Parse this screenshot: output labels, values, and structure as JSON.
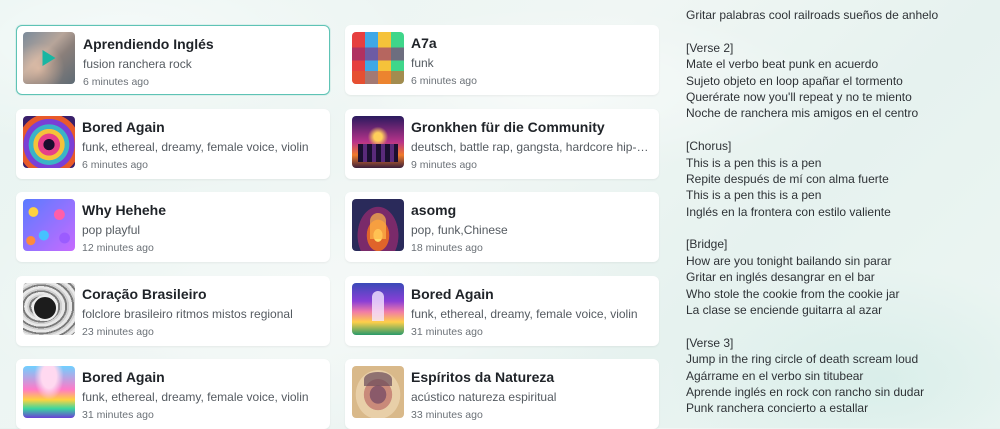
{
  "songs": [
    {
      "title": "Aprendiendo Inglés",
      "tags": "fusion ranchera rock",
      "time": "6 minutes ago",
      "art": "aprendiendo-cover"
    },
    {
      "title": "A7a",
      "tags": "funk",
      "time": "6 minutes ago",
      "art": "a7a-cover"
    },
    {
      "title": "Bored Again",
      "tags": "funk, ethereal, dreamy, female voice, violin",
      "time": "6 minutes ago",
      "art": "bored-again-cover-1"
    },
    {
      "title": "Gronkhen für die Community",
      "tags": "deutsch, battle rap, gangsta, hardcore hip-hop",
      "time": "9 minutes ago",
      "art": "gronkhen-cover"
    },
    {
      "title": "Why Hehehe",
      "tags": "pop playful",
      "time": "12 minutes ago",
      "art": "why-hehehe-cover"
    },
    {
      "title": "asomg",
      "tags": "pop, funk,Chinese",
      "time": "18 minutes ago",
      "art": "asomg-cover"
    },
    {
      "title": "Coração Brasileiro",
      "tags": "folclore brasileiro ritmos mistos regional",
      "time": "23 minutes ago",
      "art": "coracao-cover"
    },
    {
      "title": "Bored Again",
      "tags": "funk, ethereal, dreamy, female voice, violin",
      "time": "31 minutes ago",
      "art": "bored-again-cover-2"
    },
    {
      "title": "Bored Again",
      "tags": "funk, ethereal, dreamy, female voice, violin",
      "time": "31 minutes ago",
      "art": "bored-again-cover-3"
    },
    {
      "title": "Espíritos da Natureza",
      "tags": "acústico natureza espiritual",
      "time": "33 minutes ago",
      "art": "espiritos-cover"
    }
  ],
  "lyrics": [
    "Gritar palabras cool railroads sueños de anhelo",
    "",
    "[Verse 2]",
    "Mate el verbo beat punk en acuerdo",
    "Sujeto objeto en loop apañar el tormento",
    "Querérate now you'll repeat y no te miento",
    "Noche de ranchera mis amigos en el centro",
    "",
    "[Chorus]",
    "This is a pen this is a pen",
    "Repite después de mí con alma fuerte",
    "This is a pen this is a pen",
    "Inglés en la frontera con estilo valiente",
    "",
    "[Bridge]",
    "How are you tonight bailando sin parar",
    "Gritar en inglés desangrar en el bar",
    "Who stole the cookie from the cookie jar",
    "La clase se enciende guitarra al azar",
    "",
    "[Verse 3]",
    "Jump in the ring circle of death scream loud",
    "Agárrame en el verbo sin titubear",
    "Aprende inglés en rock con rancho sin dudar",
    "Punk ranchera concierto a estallar"
  ],
  "colors": {
    "accent": "#19b6a2",
    "selected_border": "#5ec3b5"
  }
}
